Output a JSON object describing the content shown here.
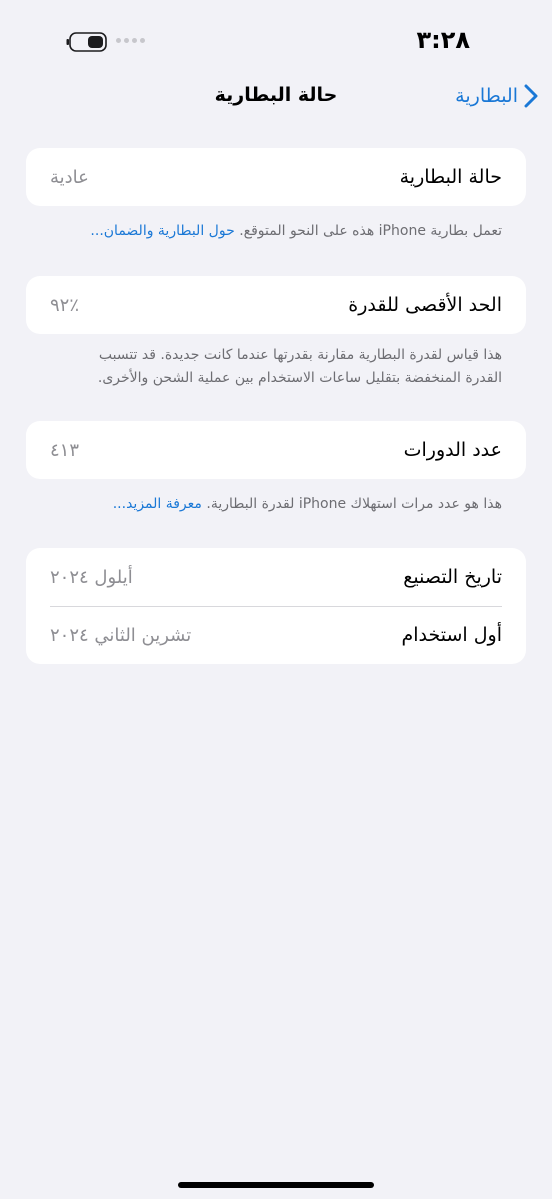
{
  "status_bar": {
    "time": "٣:٢٨",
    "battery_icon": "battery-low-icon",
    "signal_icon": "no-signal-dots-icon"
  },
  "nav": {
    "title": "حالة البطارية",
    "back_label": "البطارية",
    "back_icon": "chevron-right-icon"
  },
  "battery_health": {
    "label": "حالة البطارية",
    "value": "عادية",
    "footnote_text": "تعمل بطارية iPhone هذه على النحو المتوقع.",
    "footnote_link": "حول البطارية والضمان..."
  },
  "max_capacity": {
    "label": "الحد الأقصى للقدرة",
    "value": "٪٩٢",
    "footnote_line1": "هذا قياس لقدرة البطارية مقارنة بقدرتها عندما كانت جديدة. قد تتسبب",
    "footnote_line2": "القدرة المنخفضة بتقليل ساعات الاستخدام بين عملية الشحن والأخرى."
  },
  "cycle_count": {
    "label": "عدد الدورات",
    "value": "٤١٣",
    "footnote_text": "هذا هو عدد مرات استهلاك iPhone لقدرة البطارية.",
    "footnote_link": "معرفة المزيد..."
  },
  "dates": {
    "manufacture_label": "تاريخ التصنيع",
    "manufacture_value": "أيلول ٢٠٢٤",
    "first_use_label": "أول استخدام",
    "first_use_value": "تشرين الثاني ٢٠٢٤"
  },
  "colors": {
    "accent": "#1a78d6",
    "background": "#f2f2f7",
    "secondary_text": "#8e8e93"
  }
}
